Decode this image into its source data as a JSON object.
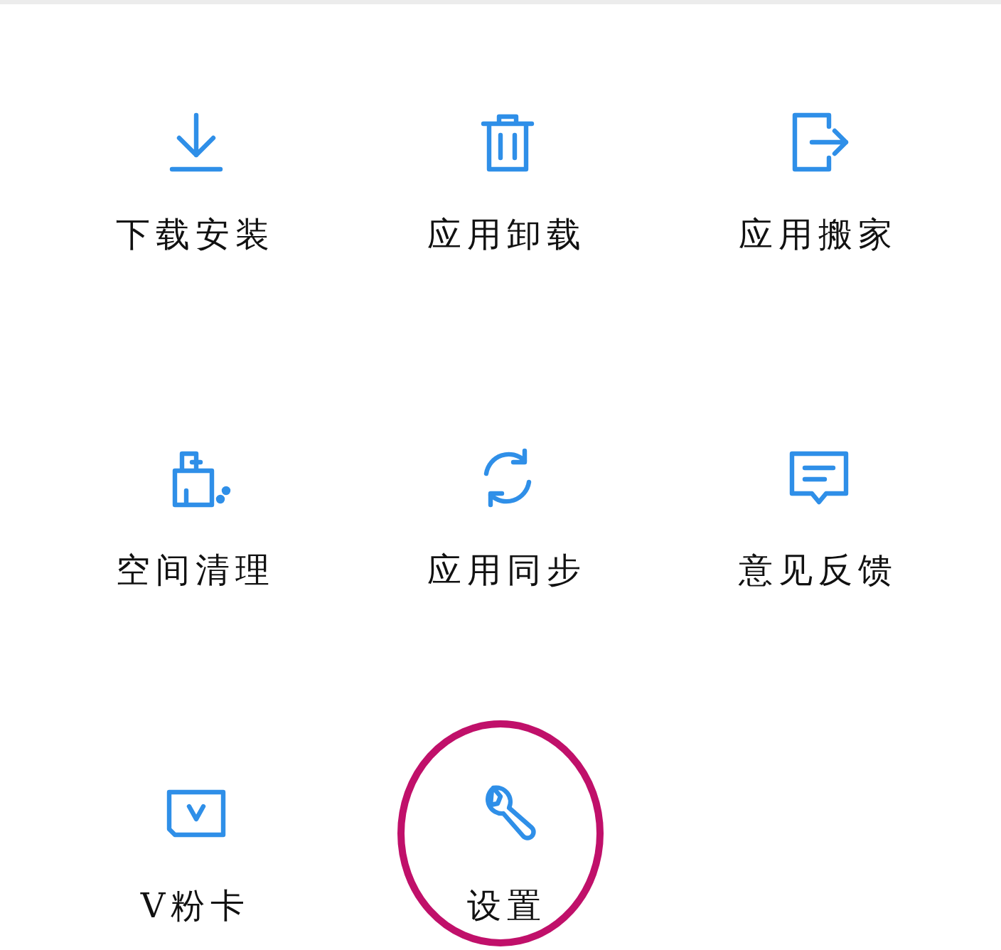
{
  "items": [
    {
      "kind": "download",
      "label": "下载安装",
      "highlighted": false
    },
    {
      "kind": "trash",
      "label": "应用卸载",
      "highlighted": false
    },
    {
      "kind": "move",
      "label": "应用搬家",
      "highlighted": false
    },
    {
      "kind": "clean",
      "label": "空间清理",
      "highlighted": false
    },
    {
      "kind": "sync",
      "label": "应用同步",
      "highlighted": false
    },
    {
      "kind": "feedback",
      "label": "意见反馈",
      "highlighted": false
    },
    {
      "kind": "card",
      "label": "V粉卡",
      "highlighted": false
    },
    {
      "kind": "wrench",
      "label": "设置",
      "highlighted": true
    }
  ]
}
